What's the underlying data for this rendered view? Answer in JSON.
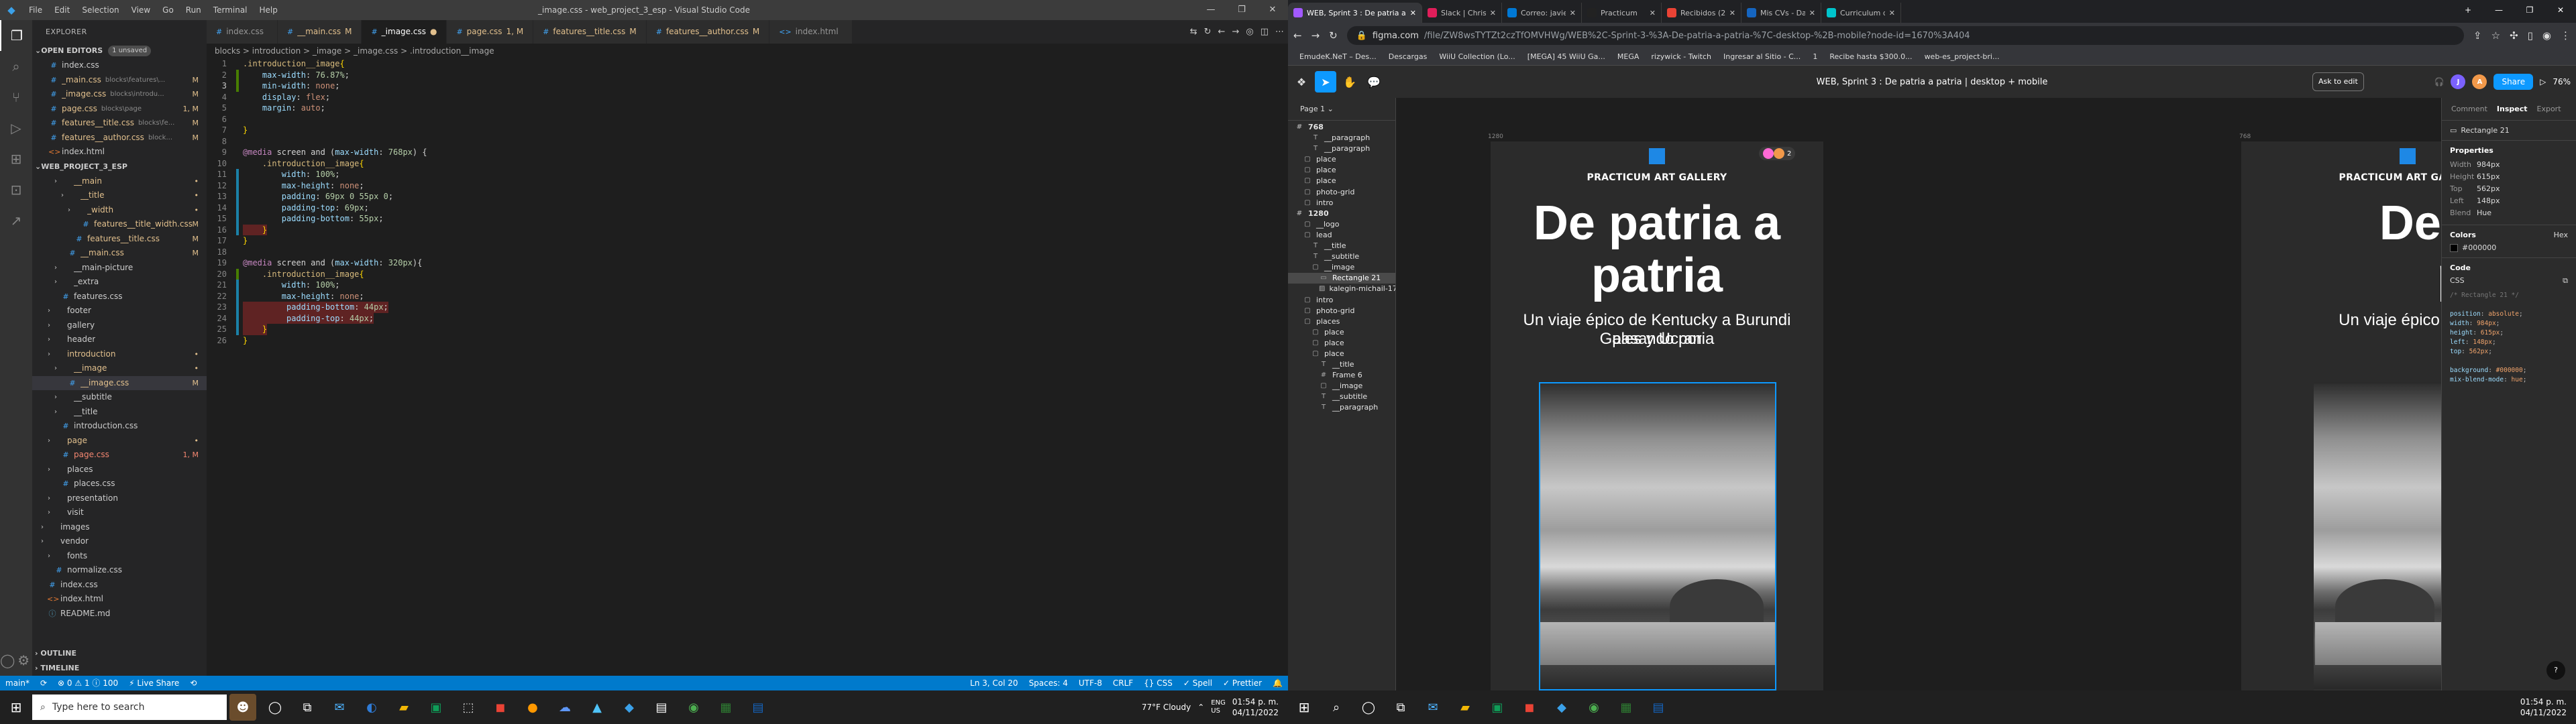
{
  "vscode": {
    "window_title": "_image.css - web_project_3_esp - Visual Studio Code",
    "menu": [
      "File",
      "Edit",
      "Selection",
      "View",
      "Go",
      "Run",
      "Terminal",
      "Help"
    ],
    "explorer_title": "EXPLORER",
    "open_editors": {
      "label": "OPEN EDITORS",
      "badge": "1 unsaved"
    },
    "open_files": [
      {
        "name": "index.css",
        "path": "",
        "status": ""
      },
      {
        "name": "_main.css",
        "path": "blocks\\features\\...",
        "status": "M"
      },
      {
        "name": "_image.css",
        "path": "blocks\\introdu...",
        "status": "M"
      },
      {
        "name": "page.css",
        "path": "blocks\\page",
        "status": "1, M"
      },
      {
        "name": "features__title.css",
        "path": "blocks\\fe...",
        "status": "M"
      },
      {
        "name": "features__author.css",
        "path": "block...",
        "status": "M"
      },
      {
        "name": "index.html",
        "path": "",
        "status": ""
      }
    ],
    "project_label": "WEB_PROJECT_3_ESP",
    "tree": [
      {
        "label": "__main",
        "kind": "folder",
        "status": "dot"
      },
      {
        "label": "__title",
        "kind": "folder",
        "status": "dot"
      },
      {
        "label": "_width",
        "kind": "folder",
        "status": "dot"
      },
      {
        "label": "features__title_width.css",
        "kind": "css",
        "status": "M"
      },
      {
        "label": "features__title.css",
        "kind": "css",
        "status": "M"
      },
      {
        "label": "__main.css",
        "kind": "css",
        "status": "M"
      },
      {
        "label": "__main-picture",
        "kind": "folder",
        "status": ""
      },
      {
        "label": "_extra",
        "kind": "folder",
        "status": ""
      },
      {
        "label": "features.css",
        "kind": "css",
        "status": ""
      },
      {
        "label": "footer",
        "kind": "folder",
        "status": ""
      },
      {
        "label": "gallery",
        "kind": "folder",
        "status": ""
      },
      {
        "label": "header",
        "kind": "folder",
        "status": ""
      },
      {
        "label": "introduction",
        "kind": "folder",
        "status": "dot"
      },
      {
        "label": "__image",
        "kind": "folder",
        "status": "dot"
      },
      {
        "label": "__image.css",
        "kind": "css",
        "status": "M"
      },
      {
        "label": "__subtitle",
        "kind": "folder",
        "status": ""
      },
      {
        "label": "__title",
        "kind": "folder",
        "status": ""
      },
      {
        "label": "introduction.css",
        "kind": "css",
        "status": ""
      },
      {
        "label": "page",
        "kind": "folder",
        "status": "dot"
      },
      {
        "label": "page.css",
        "kind": "css",
        "status": "1, M"
      },
      {
        "label": "places",
        "kind": "folder",
        "status": ""
      },
      {
        "label": "places.css",
        "kind": "css",
        "status": ""
      },
      {
        "label": "presentation",
        "kind": "folder",
        "status": ""
      },
      {
        "label": "visit",
        "kind": "folder",
        "status": ""
      },
      {
        "label": "images",
        "kind": "folder",
        "status": ""
      },
      {
        "label": "vendor",
        "kind": "folder",
        "status": ""
      },
      {
        "label": "fonts",
        "kind": "folder",
        "status": ""
      },
      {
        "label": "normalize.css",
        "kind": "css",
        "status": ""
      },
      {
        "label": "index.css",
        "kind": "css",
        "status": ""
      },
      {
        "label": "index.html",
        "kind": "html",
        "status": ""
      },
      {
        "label": "README.md",
        "kind": "md",
        "status": ""
      }
    ],
    "outline": "OUTLINE",
    "timeline": "TIMELINE",
    "tabs": [
      {
        "name": "index.css",
        "mod": ""
      },
      {
        "name": "__main.css",
        "mod": "M"
      },
      {
        "name": "_image.css",
        "mod": "●"
      },
      {
        "name": "page.css",
        "mod": "1, M"
      },
      {
        "name": "features__title.css",
        "mod": "M"
      },
      {
        "name": "features__author.css",
        "mod": "M"
      },
      {
        "name": "index.html",
        "mod": ""
      }
    ],
    "breadcrumb": "blocks > introduction > _image > _image.css > .introduction__image",
    "code": [
      ".introduction__image{",
      "    max-width: 76.87%;",
      "    min-width: none;",
      "    display: flex;",
      "    margin: auto;",
      "",
      "}",
      "",
      "@media screen and (max-width: 768px) {",
      "    .introduction__image{",
      "        width: 100%;",
      "        max-height: none;",
      "        padding: 69px 0 55px 0;",
      "        padding-top: 69px;",
      "        padding-bottom: 55px;",
      "    }",
      "}",
      "",
      "@media screen and (max-width: 320px){",
      "    .introduction__image{",
      "        width: 100%;",
      "        max-height: none;",
      "         padding-bottom: 44px;",
      "         padding-top: 44px;",
      "    }",
      "}"
    ],
    "status_left": [
      "main*",
      "⟳",
      "⊗ 0 ⚠ 1 ⓘ 100",
      "⚡ Live Share",
      "⟲"
    ],
    "status_right": [
      "Ln 3, Col 20",
      "Spaces: 4",
      "UTF-8",
      "CRLF",
      "{} CSS",
      "✓ Spell",
      "✓ Prettier",
      "🔔"
    ]
  },
  "browser": {
    "tabs": [
      {
        "title": "WEB, Sprint 3 : De patria a patria",
        "color": "#a259ff"
      },
      {
        "title": "Slack | Christian Garcia | Practic...",
        "color": "#e01e5a"
      },
      {
        "title": "Correo: javier antonio benitez ...",
        "color": "#0078d4"
      },
      {
        "title": "Practicum",
        "color": "#222222"
      },
      {
        "title": "Recibidos (2,231) - javiercastill...",
        "color": "#ea4335"
      },
      {
        "title": "Mis CVs - Dashboard | OCCMun...",
        "color": "#1565c0"
      },
      {
        "title": "Curriculum de mujer Profesional...",
        "color": "#00c4cc"
      }
    ],
    "url_host": "figma.com",
    "url_path": "/file/ZW8wsTYTZt2czTfOMVHWg/WEB%2C-Sprint-3-%3A-De-patria-a-patria-%7C-desktop-%2B-mobile?node-id=1670%3A404",
    "bookmarks": [
      "EmudeK.NeT – Des...",
      "Descargas",
      "WiiU Collection (Lo...",
      "[MEGA] 45 WiiU Ga...",
      "MEGA",
      "rizywick - Twitch",
      "Ingresar al Sitio - C...",
      "1",
      "Recibe hasta $300.0...",
      "web-es_project-bri..."
    ]
  },
  "figma": {
    "file_title": "WEB, Sprint 3 : De patria a patria  |  desktop + mobile",
    "ask_edit": "Ask to edit",
    "share": "Share",
    "zoom": "76%",
    "avatars": [
      "J",
      "A"
    ],
    "page": "Page 1",
    "layers": [
      {
        "label": "768",
        "indent": 0,
        "icon": "#",
        "frame": true
      },
      {
        "label": "__paragraph",
        "indent": 2,
        "icon": "T"
      },
      {
        "label": "__paragraph",
        "indent": 2,
        "icon": "T"
      },
      {
        "label": "place",
        "indent": 1,
        "icon": "▢"
      },
      {
        "label": "place",
        "indent": 1,
        "icon": "▢"
      },
      {
        "label": "place",
        "indent": 1,
        "icon": "▢"
      },
      {
        "label": "photo-grid",
        "indent": 1,
        "icon": "▢"
      },
      {
        "label": "intro",
        "indent": 1,
        "icon": "▢"
      },
      {
        "label": "1280",
        "indent": 0,
        "icon": "#",
        "frame": true
      },
      {
        "label": "__logo",
        "indent": 1,
        "icon": "▢"
      },
      {
        "label": "lead",
        "indent": 1,
        "icon": "▢"
      },
      {
        "label": "__title",
        "indent": 2,
        "icon": "T"
      },
      {
        "label": "__subtitle",
        "indent": 2,
        "icon": "T"
      },
      {
        "label": "__image",
        "indent": 2,
        "icon": "▢"
      },
      {
        "label": "Rectangle 21",
        "indent": 3,
        "icon": "▭",
        "sel": true
      },
      {
        "label": "kalegin-michail-1766...",
        "indent": 3,
        "icon": "▨"
      },
      {
        "label": "intro",
        "indent": 1,
        "icon": "▢"
      },
      {
        "label": "photo-grid",
        "indent": 1,
        "icon": "▢"
      },
      {
        "label": "places",
        "indent": 1,
        "icon": "▢"
      },
      {
        "label": "place",
        "indent": 2,
        "icon": "▢"
      },
      {
        "label": "place",
        "indent": 2,
        "icon": "▢"
      },
      {
        "label": "place",
        "indent": 2,
        "icon": "▢"
      },
      {
        "label": "__title",
        "indent": 3,
        "icon": "T"
      },
      {
        "label": "Frame 6",
        "indent": 3,
        "icon": "#"
      },
      {
        "label": "__image",
        "indent": 3,
        "icon": "▢"
      },
      {
        "label": "__subtitle",
        "indent": 3,
        "icon": "T"
      },
      {
        "label": "__paragraph",
        "indent": 3,
        "icon": "T"
      }
    ],
    "frame_labels": [
      "1280",
      "768"
    ],
    "brand": "PRACTICUM ART GALLERY",
    "hero_line1": "De patria a",
    "hero_line2": "patria",
    "subtitle_line1": "Un viaje épico de Kentucky a Burundi pasando por",
    "subtitle_line2": "Gales y Ucrania",
    "collab_count": "2",
    "right_tabs": [
      "Comment",
      "Inspect",
      "Export"
    ],
    "selected_name": "Rectangle 21",
    "properties_title": "Properties",
    "properties": [
      {
        "k": "Width",
        "v": "984px"
      },
      {
        "k": "Height",
        "v": "615px"
      },
      {
        "k": "Top",
        "v": "562px"
      },
      {
        "k": "Left",
        "v": "148px"
      },
      {
        "k": "Blend",
        "v": "Hue"
      }
    ],
    "colors_title": "Colors",
    "color_format": "Hex",
    "color_value": "#000000",
    "code_title": "Code",
    "code_lang": "CSS",
    "code_comment": "/* Rectangle 21 */",
    "css_lines": [
      {
        "p": "position",
        "v": "absolute"
      },
      {
        "p": "width",
        "v": "984px"
      },
      {
        "p": "height",
        "v": "615px"
      },
      {
        "p": "left",
        "v": "148px"
      },
      {
        "p": "top",
        "v": "562px"
      },
      {
        "p": "background",
        "v": "#000000"
      },
      {
        "p": "mix-blend-mode",
        "v": "hue"
      }
    ]
  },
  "taskbar": {
    "search_placeholder": "Type here to search",
    "weather": "77°F  Cloudy",
    "lang": "ENG\nUS",
    "time": "01:54 p. m.",
    "date": "04/11/2022"
  }
}
